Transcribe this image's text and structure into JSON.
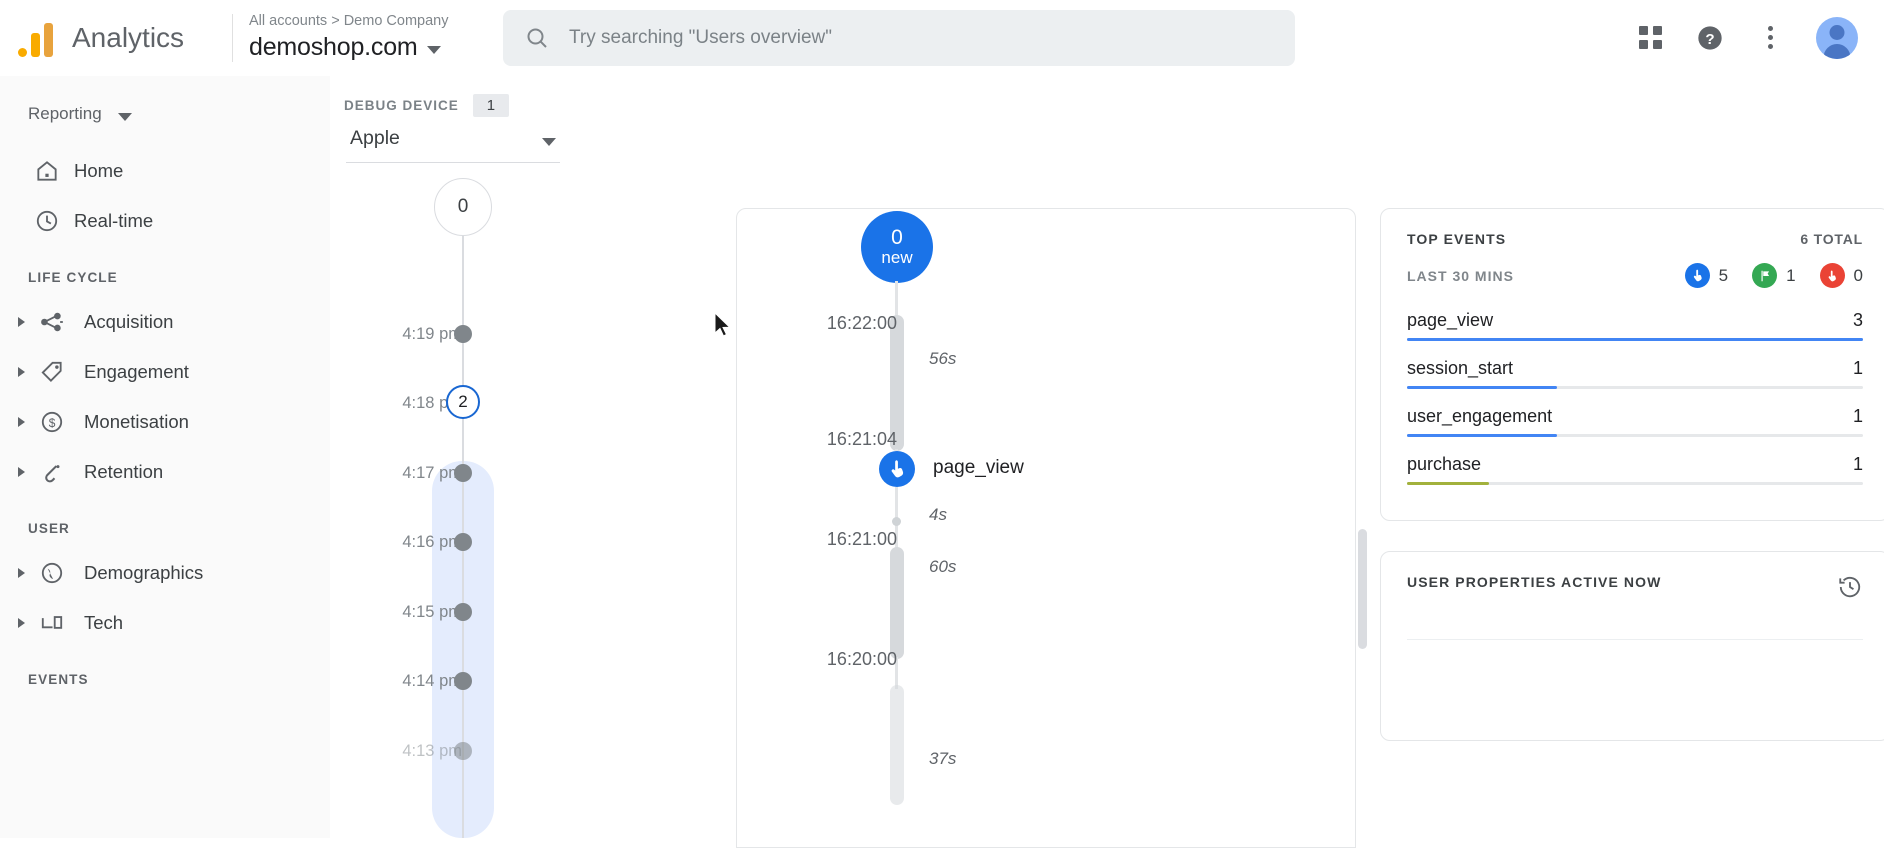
{
  "topbar": {
    "brand": "Analytics",
    "breadcrumb": "All accounts > Demo Company",
    "property": "demoshop.com",
    "search_placeholder": "Try searching \"Users overview\"",
    "icons": {
      "search": "search-icon",
      "apps": "apps-grid-icon",
      "help": "help-circle-icon",
      "more": "more-vert-icon",
      "avatar": "user-avatar"
    }
  },
  "sidebar": {
    "reporting_label": "Reporting",
    "primary": [
      {
        "label": "Home",
        "icon": "home-icon"
      },
      {
        "label": "Real-time",
        "icon": "clock-icon"
      }
    ],
    "sections": [
      {
        "title": "LIFE CYCLE",
        "items": [
          {
            "label": "Acquisition",
            "icon": "share-nodes-icon"
          },
          {
            "label": "Engagement",
            "icon": "tag-icon"
          },
          {
            "label": "Monetisation",
            "icon": "dollar-circle-icon"
          },
          {
            "label": "Retention",
            "icon": "retention-arrow-icon"
          }
        ]
      },
      {
        "title": "USER",
        "items": [
          {
            "label": "Demographics",
            "icon": "globe-icon"
          },
          {
            "label": "Tech",
            "icon": "devices-icon"
          }
        ]
      },
      {
        "title": "EVENTS",
        "items": []
      }
    ]
  },
  "debug_device": {
    "label": "DEBUG DEVICE",
    "count": "1",
    "selected": "Apple"
  },
  "minute_stream": {
    "now_bubble": "0",
    "rows": [
      {
        "time": "4:19 pm",
        "value": "",
        "active": false,
        "faded": false
      },
      {
        "time": "4:18 pm",
        "value": "2",
        "active": true,
        "faded": false
      },
      {
        "time": "4:17 pm",
        "value": "",
        "active": false,
        "faded": false
      },
      {
        "time": "4:16 pm",
        "value": "",
        "active": false,
        "faded": false
      },
      {
        "time": "4:15 pm",
        "value": "",
        "active": false,
        "faded": false
      },
      {
        "time": "4:14 pm",
        "value": "",
        "active": false,
        "faded": false
      },
      {
        "time": "4:13 pm",
        "value": "",
        "active": false,
        "faded": true
      }
    ]
  },
  "event_stream": {
    "new_count": "0",
    "new_label": "new",
    "entries": [
      {
        "time": "16:22:00",
        "duration": "56s",
        "event": ""
      },
      {
        "time": "16:21:04",
        "duration": "4s",
        "event": "page_view"
      },
      {
        "time": "16:21:00",
        "duration": "60s",
        "event": ""
      },
      {
        "time": "16:20:00",
        "duration": "37s",
        "event": ""
      }
    ]
  },
  "top_events": {
    "title": "TOP EVENTS",
    "total": "6 TOTAL",
    "subhead": "LAST 30 MINS",
    "stats": [
      {
        "icon": "touch-event-icon",
        "color": "#1a73e8",
        "value": "5"
      },
      {
        "icon": "conversion-flag-icon",
        "color": "#34a853",
        "value": "1"
      },
      {
        "icon": "error-event-icon",
        "color": "#ea4335",
        "value": "0"
      }
    ],
    "rows": [
      {
        "name": "page_view",
        "value": "3",
        "pct": 100,
        "color": "#4285f4"
      },
      {
        "name": "session_start",
        "value": "1",
        "pct": 33,
        "color": "#4285f4"
      },
      {
        "name": "user_engagement",
        "value": "1",
        "pct": 33,
        "color": "#4285f4"
      },
      {
        "name": "purchase",
        "value": "1",
        "pct": 18,
        "color": "#a2b13c"
      }
    ]
  },
  "user_properties": {
    "title": "USER PROPERTIES ACTIVE NOW",
    "history_icon": "history-clock-icon"
  }
}
